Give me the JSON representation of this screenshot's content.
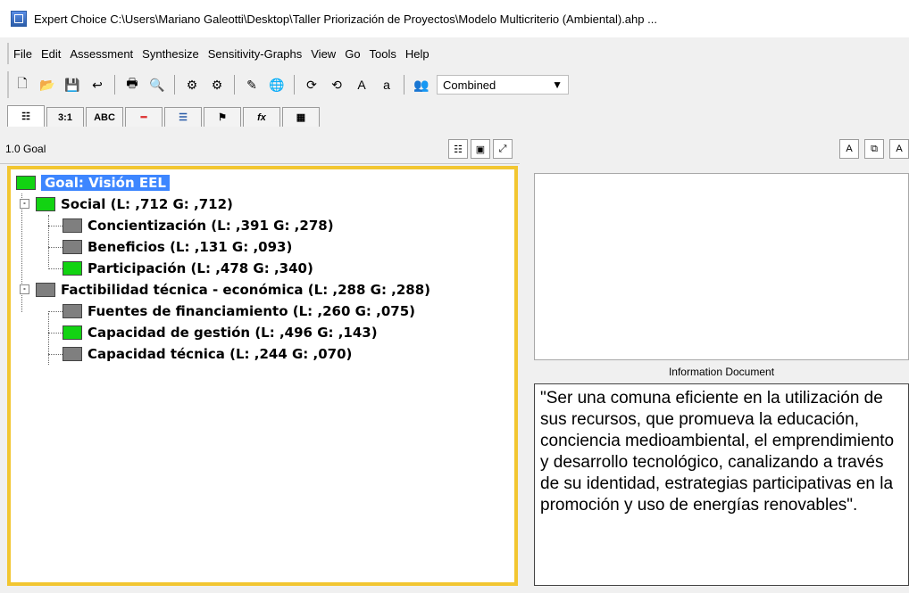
{
  "window": {
    "title": "Expert Choice    C:\\Users\\Mariano Galeotti\\Desktop\\Taller Priorización de Proyectos\\Modelo Multicriterio (Ambiental).ahp  ..."
  },
  "menu": {
    "items": [
      "File",
      "Edit",
      "Assessment",
      "Synthesize",
      "Sensitivity-Graphs",
      "View",
      "Go",
      "Tools",
      "Help"
    ]
  },
  "toolbar": {
    "combined_value": "Combined",
    "dropdown_arrow": "▼"
  },
  "tabs": [
    {
      "label": "",
      "icon": "hierarchy-icon"
    },
    {
      "label": "3:1",
      "icon": ""
    },
    {
      "label": "ABC",
      "icon": ""
    },
    {
      "label": "",
      "icon": "bar-red-icon"
    },
    {
      "label": "",
      "icon": "bar-blue-icon"
    },
    {
      "label": "",
      "icon": "merge-icon"
    },
    {
      "label": "fx",
      "icon": ""
    },
    {
      "label": "",
      "icon": "grid-icon"
    }
  ],
  "left_panel": {
    "header_label": "1.0 Goal",
    "tree": [
      {
        "text": "Goal: Visión EEL",
        "level": 0,
        "color": "green",
        "selected": true
      },
      {
        "text": "Social (L: ,712 G: ,712)",
        "level": 1,
        "color": "green",
        "expander": "-"
      },
      {
        "text": "Concientización (L: ,391 G: ,278)",
        "level": 2,
        "color": "gray"
      },
      {
        "text": "Beneficios (L: ,131 G: ,093)",
        "level": 2,
        "color": "gray"
      },
      {
        "text": "Participación (L: ,478 G: ,340)",
        "level": 2,
        "color": "green"
      },
      {
        "text": "Factibilidad técnica - económica (L:  ,288  G:  ,288)",
        "level": 1,
        "color": "gray",
        "expander": "-"
      },
      {
        "text": "Fuentes de financiamiento (L: ,260 G: ,075)",
        "level": 2,
        "color": "gray"
      },
      {
        "text": "Capacidad de gestión (L: ,496 G: ,143)",
        "level": 2,
        "color": "green"
      },
      {
        "text": "Capacidad técnica (L:  ,244  G:  ,070)",
        "level": 2,
        "color": "gray"
      }
    ]
  },
  "right_panel": {
    "info_title": "Information Document",
    "info_text": "\"Ser una comuna eficiente en la utilización de sus recursos, que promueva la educación, conciencia medioambiental, el emprendimiento y desarrollo tecnológico, canalizando a través de su identidad, estrategias participativas en la promoción y uso de energías renovables\"."
  }
}
